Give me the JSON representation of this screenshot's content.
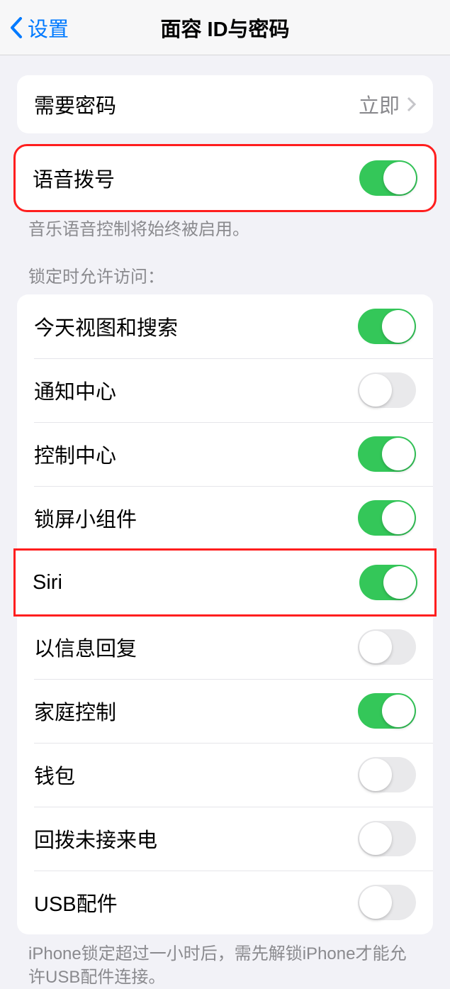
{
  "nav": {
    "back": "设置",
    "title": "面容 ID与密码"
  },
  "require_passcode": {
    "label": "需要密码",
    "value": "立即"
  },
  "voice_dial": {
    "label": "语音拨号",
    "enabled": true,
    "footer": "音乐语音控制将始终被启用。"
  },
  "lock_access": {
    "header": "锁定时允许访问：",
    "items": [
      {
        "label": "今天视图和搜索",
        "enabled": true
      },
      {
        "label": "通知中心",
        "enabled": false
      },
      {
        "label": "控制中心",
        "enabled": true
      },
      {
        "label": "锁屏小组件",
        "enabled": true
      },
      {
        "label": "Siri",
        "enabled": true
      },
      {
        "label": "以信息回复",
        "enabled": false
      },
      {
        "label": "家庭控制",
        "enabled": true
      },
      {
        "label": "钱包",
        "enabled": false
      },
      {
        "label": "回拨未接来电",
        "enabled": false
      },
      {
        "label": "USB配件",
        "enabled": false
      }
    ],
    "footer": "iPhone锁定超过一小时后，需先解锁iPhone才能允许USB配件连接。"
  }
}
